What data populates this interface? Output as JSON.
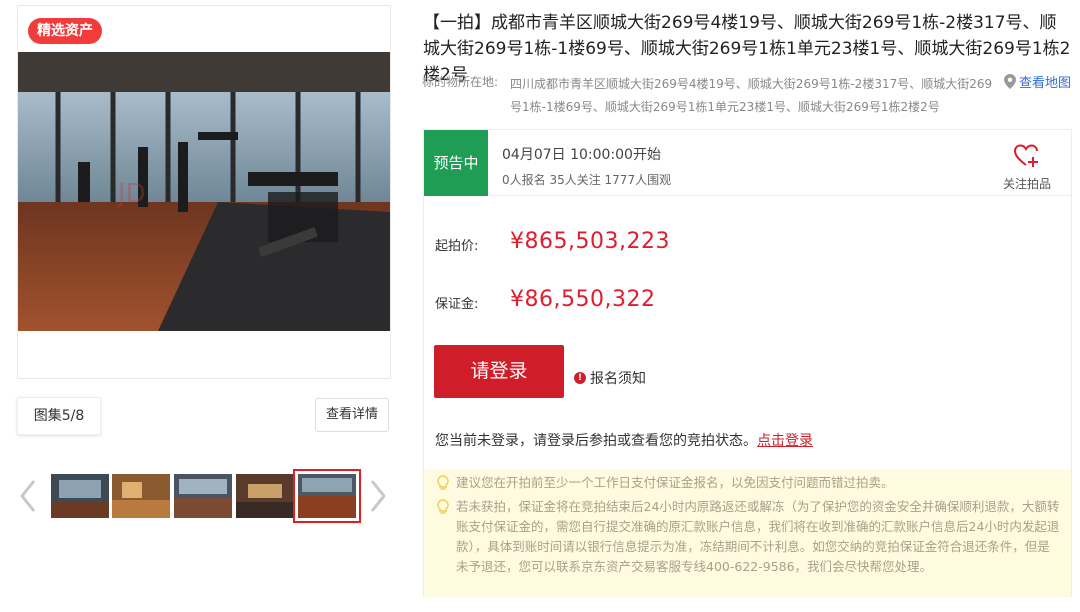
{
  "gallery": {
    "badge": "精选资产",
    "album_count": "图集5/8",
    "detail_button": "查看详情",
    "watermark": "JD",
    "thumbnails": [
      "photo-1",
      "photo-2",
      "photo-3",
      "photo-4",
      "photo-5"
    ],
    "active_thumbnail_index": 4
  },
  "listing": {
    "title": "【一拍】成都市青羊区顺城大街269号4楼19号、顺城大街269号1栋-2楼317号、顺城大街269号1栋-1楼69号、顺城大街269号1栋1单元23楼1号、顺城大街269号1栋2楼2号",
    "location_label": "标的物所在地:",
    "location_text": "四川成都市青羊区顺城大街269号4楼19号、顺城大街269号1栋-2楼317号、顺城大街269号1栋-1楼69号、顺城大街269号1栋1单元23楼1号、顺城大街269号1栋2楼2号",
    "map_link": "查看地图"
  },
  "auction": {
    "status": "预告中",
    "start_time": "04月07日 10:00:00开始",
    "stats": "0人报名  35人关注  1777人围观",
    "follow_label": "关注拍品",
    "start_price_label": "起拍价:",
    "start_price": "¥865,503,223",
    "deposit_label": "保证金:",
    "deposit": "¥86,550,322",
    "login_button": "请登录",
    "notice_link": "报名须知",
    "login_hint": "您当前未登录，请登录后参拍或查看您的竞拍状态。",
    "login_link": "点击登录"
  },
  "tips": [
    "建议您在开拍前至少一个工作日支付保证金报名，以免因支付问题而错过拍卖。",
    "若未获拍，保证金将在竞拍结束后24小时内原路返还或解冻（为了保护您的资金安全并确保顺利退款，大额转账支付保证金的，需您自行提交准确的原汇款账户信息，我们将在收到准确的汇款账户信息后24小时内发起退款），具体到账时间请以银行信息提示为准，冻结期间不计利息。如您交纳的竞拍保证金符合退还条件，但是未予退还，您可以联系京东资产交易客服专线400-622-9586，我们会尽快帮您处理。"
  ],
  "colors": {
    "accent_red": "#e01d2d",
    "status_green": "#1f9d55",
    "link_blue": "#2f6fd6",
    "tips_bg": "#fffbe0"
  }
}
